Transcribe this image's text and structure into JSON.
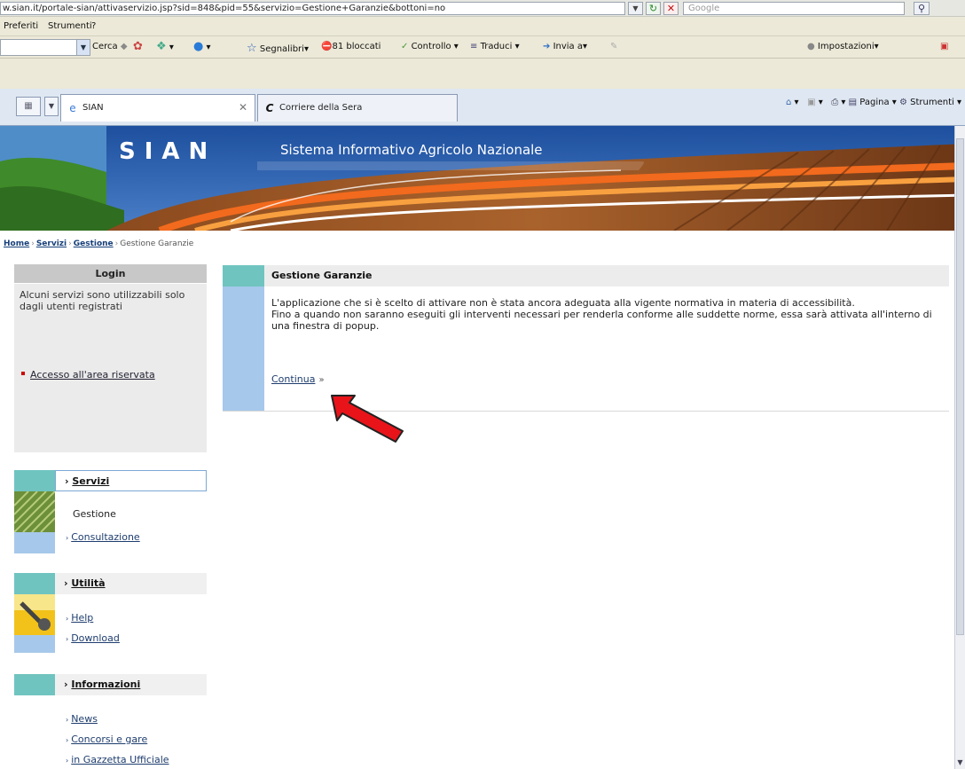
{
  "address": {
    "url": "w.sian.it/portale-sian/attivaservizio.jsp?sid=848&pid=55&servizio=Gestione+Garanzie&bottoni=no",
    "search_placeholder": "Google"
  },
  "menu": [
    "Preferiti",
    "Strumenti",
    "?"
  ],
  "toolbar": {
    "search": "Cerca",
    "bookmarks": "Segnalibri",
    "blocked": "81 bloccati",
    "check": "Controllo",
    "translate": "Traduci",
    "send": "Invia a",
    "settings": "Impostazioni"
  },
  "tabs": [
    {
      "label": "SIAN",
      "active": true
    },
    {
      "label": "Corriere della Sera",
      "active": false
    }
  ],
  "commandbar": {
    "page": "Pagina",
    "tools": "Strumenti"
  },
  "banner": {
    "title": "SIAN",
    "subtitle": "Sistema Informativo Agricolo Nazionale"
  },
  "breadcrumb": {
    "home": "Home",
    "services": "Servizi",
    "management": "Gestione",
    "current": "Gestione Garanzie"
  },
  "login": {
    "title": "Login",
    "text": "Alcuni servizi sono utilizzabili solo dagli utenti registrati",
    "link": "Accesso all'area riservata"
  },
  "servizi": {
    "title": "Servizi",
    "items": [
      "Gestione",
      "Consultazione"
    ]
  },
  "utilita": {
    "title": "Utilità",
    "items": [
      "Help",
      "Download"
    ]
  },
  "informazioni": {
    "title": "Informazioni",
    "items": [
      "News",
      "Concorsi e gare",
      "in Gazzetta Ufficiale"
    ]
  },
  "main": {
    "title": "Gestione Garanzie",
    "p1": "L'applicazione che si è scelto di attivare non è stata ancora adeguata alla vigente normativa in materia di accessibilità.",
    "p2": "Fino a quando non saranno eseguiti gli interventi necessari per renderla conforme alle suddette norme, essa sarà attivata all'interno di una finestra di popup.",
    "continue": "Continua",
    "continue_mark": "»"
  },
  "colors": {
    "accent_teal": "#6fc4c0",
    "accent_blue": "#a6c8ea",
    "banner_blue": "#2e5da8",
    "arrow_red": "#e8141a"
  }
}
